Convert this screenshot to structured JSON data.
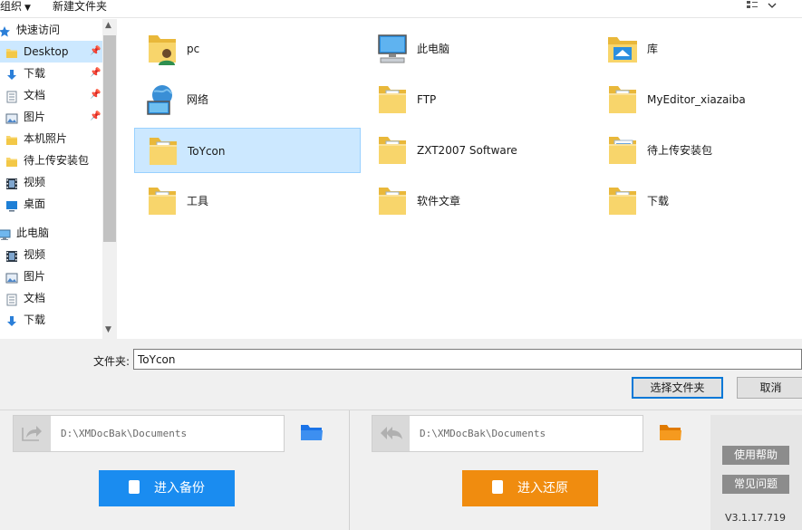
{
  "toolbar": {
    "organize": "组织",
    "new_folder": "新建文件夹"
  },
  "nav": {
    "items": [
      {
        "label": "快速访问",
        "icon": "star-icon",
        "pinned": false,
        "selected": false,
        "indent": 0
      },
      {
        "label": "Desktop",
        "icon": "folder-icon",
        "pinned": true,
        "selected": true,
        "indent": 1
      },
      {
        "label": "下载",
        "icon": "download-icon",
        "pinned": true,
        "selected": false,
        "indent": 1
      },
      {
        "label": "文档",
        "icon": "document-icon",
        "pinned": true,
        "selected": false,
        "indent": 1
      },
      {
        "label": "图片",
        "icon": "picture-icon",
        "pinned": true,
        "selected": false,
        "indent": 1
      },
      {
        "label": "本机照片",
        "icon": "folder-icon",
        "pinned": false,
        "selected": false,
        "indent": 1
      },
      {
        "label": "待上传安装包",
        "icon": "folder-icon",
        "pinned": false,
        "selected": false,
        "indent": 1
      },
      {
        "label": "视频",
        "icon": "video-icon",
        "pinned": false,
        "selected": false,
        "indent": 1
      },
      {
        "label": "桌面",
        "icon": "desktop-icon",
        "pinned": false,
        "selected": false,
        "indent": 1
      },
      {
        "label": "此电脑",
        "icon": "computer-icon",
        "pinned": false,
        "selected": false,
        "indent": 0
      },
      {
        "label": "视频",
        "icon": "video-icon",
        "pinned": false,
        "selected": false,
        "indent": 1
      },
      {
        "label": "图片",
        "icon": "picture-icon",
        "pinned": false,
        "selected": false,
        "indent": 1
      },
      {
        "label": "文档",
        "icon": "document-icon",
        "pinned": false,
        "selected": false,
        "indent": 1
      },
      {
        "label": "下载",
        "icon": "download-icon",
        "pinned": false,
        "selected": false,
        "indent": 1
      }
    ]
  },
  "grid": {
    "items": [
      {
        "label": "pc",
        "icon": "user-folder-icon",
        "selected": false
      },
      {
        "label": "此电脑",
        "icon": "computer-icon",
        "selected": false
      },
      {
        "label": "库",
        "icon": "library-icon",
        "selected": false
      },
      {
        "label": "网络",
        "icon": "network-icon",
        "selected": false
      },
      {
        "label": "FTP",
        "icon": "folder-icon",
        "selected": false
      },
      {
        "label": "MyEditor_xiazaiba",
        "icon": "folder-icon",
        "selected": false
      },
      {
        "label": "ToYcon",
        "icon": "folder-icon",
        "selected": true
      },
      {
        "label": "ZXT2007 Software",
        "icon": "folder-icon",
        "selected": false
      },
      {
        "label": "待上传安装包",
        "icon": "folder-image-icon",
        "selected": false
      },
      {
        "label": "工具",
        "icon": "folder-icon",
        "selected": false
      },
      {
        "label": "软件文章",
        "icon": "folder-icon",
        "selected": false
      },
      {
        "label": "下载",
        "icon": "folder-icon",
        "selected": false
      }
    ]
  },
  "dialog": {
    "folder_label": "文件夹:",
    "folder_value": "ToYcon",
    "select_button": "选择文件夹",
    "cancel_button": "取消"
  },
  "app": {
    "backup_path": "D:\\XMDocBak\\Documents",
    "restore_path": "D:\\XMDocBak\\Documents",
    "backup_button": "进入备份",
    "restore_button": "进入还原",
    "help_button": "使用帮助",
    "faq_button": "常见问题",
    "version": "V3.1.17.719",
    "colors": {
      "backup": "#1a8cf0",
      "restore": "#f08c0f",
      "folder_blue": "#1a73e8",
      "folder_orange": "#f08c0f"
    }
  }
}
